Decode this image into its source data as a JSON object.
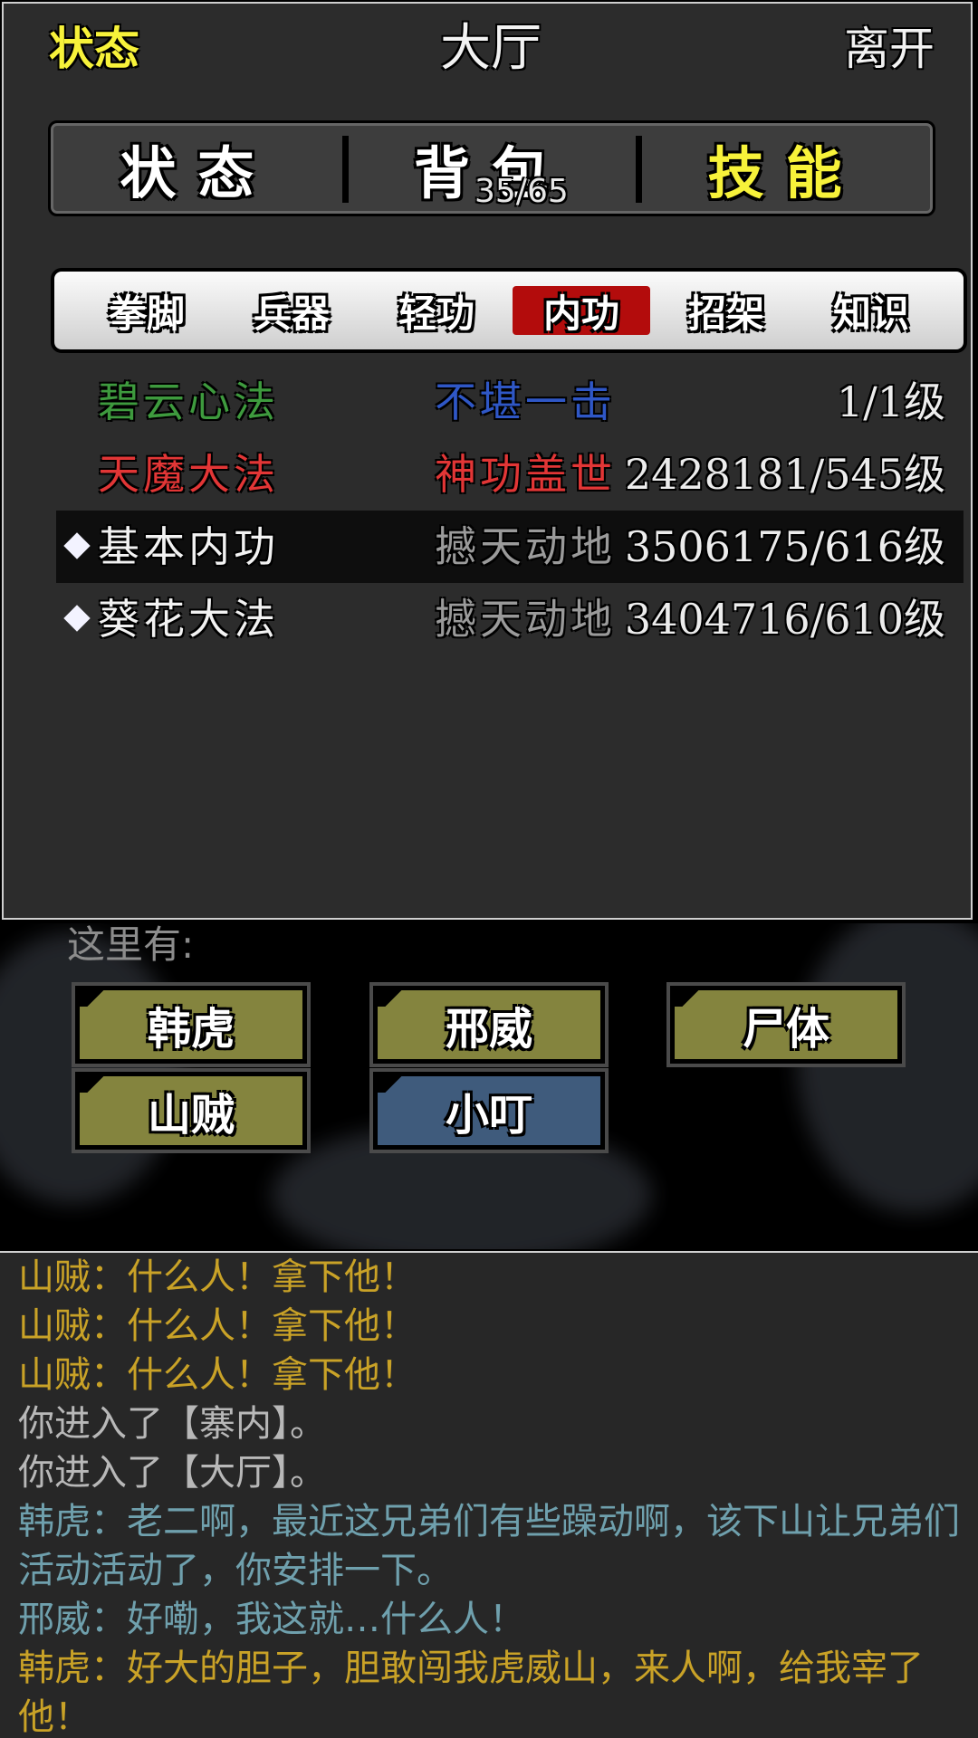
{
  "header": {
    "status_link": "状态",
    "title": "大厅",
    "leave_link": "离开"
  },
  "main_tabs": [
    {
      "label": "状态",
      "active": false
    },
    {
      "label": "背包",
      "active": false
    },
    {
      "label": "技能",
      "active": true
    }
  ],
  "bag_count": "35/65",
  "sub_tabs": [
    {
      "label": "拳脚",
      "active": false
    },
    {
      "label": "兵器",
      "active": false
    },
    {
      "label": "轻功",
      "active": false
    },
    {
      "label": "内功",
      "active": true
    },
    {
      "label": "招架",
      "active": false
    },
    {
      "label": "知识",
      "active": false
    }
  ],
  "skills": [
    {
      "name": "碧云心法",
      "grade": "不堪一击",
      "level": "1/1级",
      "name_color": "#3e9a3e",
      "grade_color": "#2f57c6",
      "marker": false,
      "selected": false
    },
    {
      "name": "天魔大法",
      "grade": "神功盖世",
      "level": "2428181/545级",
      "name_color": "#e23636",
      "grade_color": "#e23636",
      "marker": false,
      "selected": false
    },
    {
      "name": "基本内功",
      "grade": "撼天动地",
      "level": "3506175/616级",
      "name_color": "#f2f2f2",
      "grade_color": "#9a9a9a",
      "marker": true,
      "selected": true
    },
    {
      "name": "葵花大法",
      "grade": "撼天动地",
      "level": "3404716/610级",
      "name_color": "#f2f2f2",
      "grade_color": "#9a9a9a",
      "marker": true,
      "selected": false
    }
  ],
  "here": {
    "label": "这里有:",
    "npcs": [
      {
        "label": "韩虎",
        "color": "olive"
      },
      {
        "label": "邢威",
        "color": "olive"
      },
      {
        "label": "尸体",
        "color": "olive"
      },
      {
        "label": "山贼",
        "color": "olive"
      },
      {
        "label": "小叮",
        "color": "blue"
      }
    ]
  },
  "log": [
    {
      "text": "山贼：什么人！拿下他！",
      "color": "#c9a227"
    },
    {
      "text": "山贼：什么人！拿下他！",
      "color": "#c9a227"
    },
    {
      "text": "山贼：什么人！拿下他！",
      "color": "#c9a227"
    },
    {
      "text": "你进入了【寨内】。",
      "color": "#b8b8b8"
    },
    {
      "text": "你进入了【大厅】。",
      "color": "#b8b8b8"
    },
    {
      "text": "韩虎：老二啊，最近这兄弟们有些躁动啊，该下山让兄弟们活动活动了，你安排一下。",
      "color": "#6fa0ad"
    },
    {
      "text": "邢威：好嘞，我这就…什么人！",
      "color": "#6fa0ad"
    },
    {
      "text": "韩虎：好大的胆子，胆敢闯我虎威山，来人啊，给我宰了他！",
      "color": "#c9a227"
    }
  ]
}
